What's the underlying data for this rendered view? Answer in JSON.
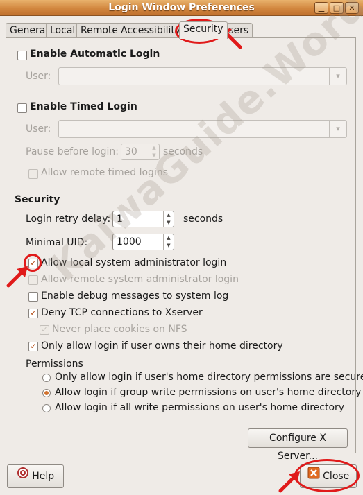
{
  "window": {
    "title": "Login Window Preferences",
    "minimize_glyph": "▁",
    "maximize_glyph": "□",
    "close_glyph": "✕"
  },
  "tabs": [
    "General",
    "Local",
    "Remote",
    "Accessibility",
    "Security",
    "Users"
  ],
  "active_tab": "Security",
  "automatic_login": {
    "label": "Enable Automatic Login",
    "checked": false,
    "user_label": "User:",
    "user_value": ""
  },
  "timed_login": {
    "label": "Enable Timed Login",
    "checked": false,
    "user_label": "User:",
    "user_value": "",
    "pause_label": "Pause before login:",
    "pause_value": "30",
    "pause_unit": "seconds",
    "allow_remote_label": "Allow remote timed logins",
    "allow_remote_checked": false
  },
  "security": {
    "heading": "Security",
    "retry_label": "Login retry delay:",
    "retry_value": "1",
    "retry_unit": "seconds",
    "uid_label": "Minimal UID:",
    "uid_value": "1000",
    "options": [
      {
        "label": "Allow local system administrator login",
        "checked": true,
        "enabled": true
      },
      {
        "label": "Allow remote system administrator login",
        "checked": false,
        "enabled": false
      },
      {
        "label": "Enable debug messages to system log",
        "checked": false,
        "enabled": true
      },
      {
        "label": "Deny TCP connections to Xserver",
        "checked": true,
        "enabled": true
      },
      {
        "label": "Never place cookies on NFS",
        "checked": true,
        "enabled": false
      },
      {
        "label": "Only allow login if user owns their home directory",
        "checked": true,
        "enabled": true
      }
    ],
    "permissions_label": "Permissions",
    "permissions": [
      {
        "label": "Only allow login if user's home directory permissions are secure",
        "selected": false
      },
      {
        "label": "Allow login if group write permissions on user's home directory",
        "selected": true
      },
      {
        "label": "Allow login if all write permissions on user's home directory",
        "selected": false
      }
    ],
    "configure_button": "Configure X Server..."
  },
  "footer": {
    "help_label": "Help",
    "close_label": "Close"
  },
  "watermark": "KaiwaGuide.WordPress.Com",
  "colors": {
    "titlebar": "#d2873f",
    "accent": "#d1722e",
    "annotation": "#e01a1a"
  },
  "icons": {
    "combo_arrow": "▾",
    "spin_up": "▲",
    "spin_down": "▼",
    "check": "✓"
  }
}
